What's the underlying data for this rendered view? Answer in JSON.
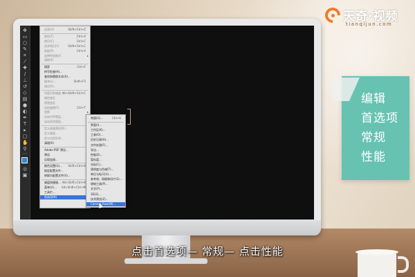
{
  "logo": {
    "brand": "天奇·视频",
    "domain": "tianqijun.com",
    "accent": "#f07b2a"
  },
  "panel": {
    "lines": [
      "编辑",
      "首选项",
      "常规",
      "性能"
    ],
    "color": "#67c2b2"
  },
  "subtitle": "点击首选项— 常规— 点击性能",
  "edit_menu": {
    "items": [
      {
        "label": "还原(O)",
        "shortcut": "Shift+Ctrl+Z"
      },
      {
        "label": "剪切(T)",
        "shortcut": "Ctrl+X"
      },
      {
        "label": "拷贝(C)",
        "shortcut": "Ctrl+C"
      },
      {
        "label": "合并拷贝(Y)",
        "shortcut": "Shift+Ctrl+C"
      },
      {
        "label": "粘贴(P)",
        "shortcut": "Ctrl+V"
      },
      {
        "label": "选择性粘贴(I)",
        "shortcut": ""
      },
      {
        "label": "清除(E)",
        "shortcut": ""
      },
      {
        "label": "搜索",
        "shortcut": "Ctrl+F"
      },
      {
        "label": "拼写检查(H)...",
        "shortcut": ""
      },
      {
        "label": "查找和替换文本(X)...",
        "shortcut": ""
      },
      {
        "label": "填充(L)...",
        "shortcut": "Shift+F5"
      },
      {
        "label": "描边(S)...",
        "shortcut": ""
      },
      {
        "label": "内容识别缩放",
        "shortcut": "Alt+Shift+Ctrl+C"
      },
      {
        "label": "操控变形",
        "shortcut": ""
      },
      {
        "label": "透视变形",
        "shortcut": ""
      },
      {
        "label": "自由变换(F)",
        "shortcut": "Ctrl+T"
      },
      {
        "label": "变换",
        "shortcut": ""
      },
      {
        "label": "自动对齐图层...",
        "shortcut": ""
      },
      {
        "label": "自动混合图层...",
        "shortcut": ""
      },
      {
        "label": "定义画笔预设(B)...",
        "shortcut": ""
      },
      {
        "label": "定义图案...",
        "shortcut": ""
      },
      {
        "label": "定义自定形状...",
        "shortcut": ""
      },
      {
        "label": "清理(R)",
        "shortcut": ""
      },
      {
        "label": "Adobe PDF 预设...",
        "shortcut": ""
      },
      {
        "label": "预设",
        "shortcut": ""
      },
      {
        "label": "远程连接...",
        "shortcut": ""
      },
      {
        "label": "颜色设置(G)...",
        "shortcut": "Shift+Ctrl+K"
      },
      {
        "label": "指定配置文件...",
        "shortcut": ""
      },
      {
        "label": "转换为配置文件(V)...",
        "shortcut": ""
      },
      {
        "label": "键盘快捷键...",
        "shortcut": "Alt+Shift+Ctrl+K"
      },
      {
        "label": "菜单(U)...",
        "shortcut": "Alt+Shift+Ctrl+M"
      },
      {
        "label": "工具栏...",
        "shortcut": ""
      },
      {
        "label": "首选项(N)",
        "shortcut": ""
      }
    ]
  },
  "prefs_submenu": {
    "items": [
      {
        "label": "常规(G)...",
        "shortcut": "Ctrl+K"
      },
      {
        "label": "界面(I)...",
        "shortcut": ""
      },
      {
        "label": "工作区(K)...",
        "shortcut": ""
      },
      {
        "label": "工具(O)...",
        "shortcut": ""
      },
      {
        "label": "历史记录(H)...",
        "shortcut": ""
      },
      {
        "label": "文件处理(F)...",
        "shortcut": ""
      },
      {
        "label": "导出...",
        "shortcut": ""
      },
      {
        "label": "性能(E)...",
        "shortcut": ""
      },
      {
        "label": "暂存盘...",
        "shortcut": ""
      },
      {
        "label": "光标(C)...",
        "shortcut": ""
      },
      {
        "label": "透明度与色域(T)...",
        "shortcut": ""
      },
      {
        "label": "单位与标尺(U)...",
        "shortcut": ""
      },
      {
        "label": "参考线、网格和切片(S)...",
        "shortcut": ""
      },
      {
        "label": "增效工具(P)...",
        "shortcut": ""
      },
      {
        "label": "文字(Y)...",
        "shortcut": ""
      },
      {
        "label": "3D(3)...",
        "shortcut": ""
      },
      {
        "label": "技术预览(Z)...",
        "shortcut": ""
      },
      {
        "label": "Camera Raw(W)...",
        "shortcut": ""
      }
    ]
  }
}
